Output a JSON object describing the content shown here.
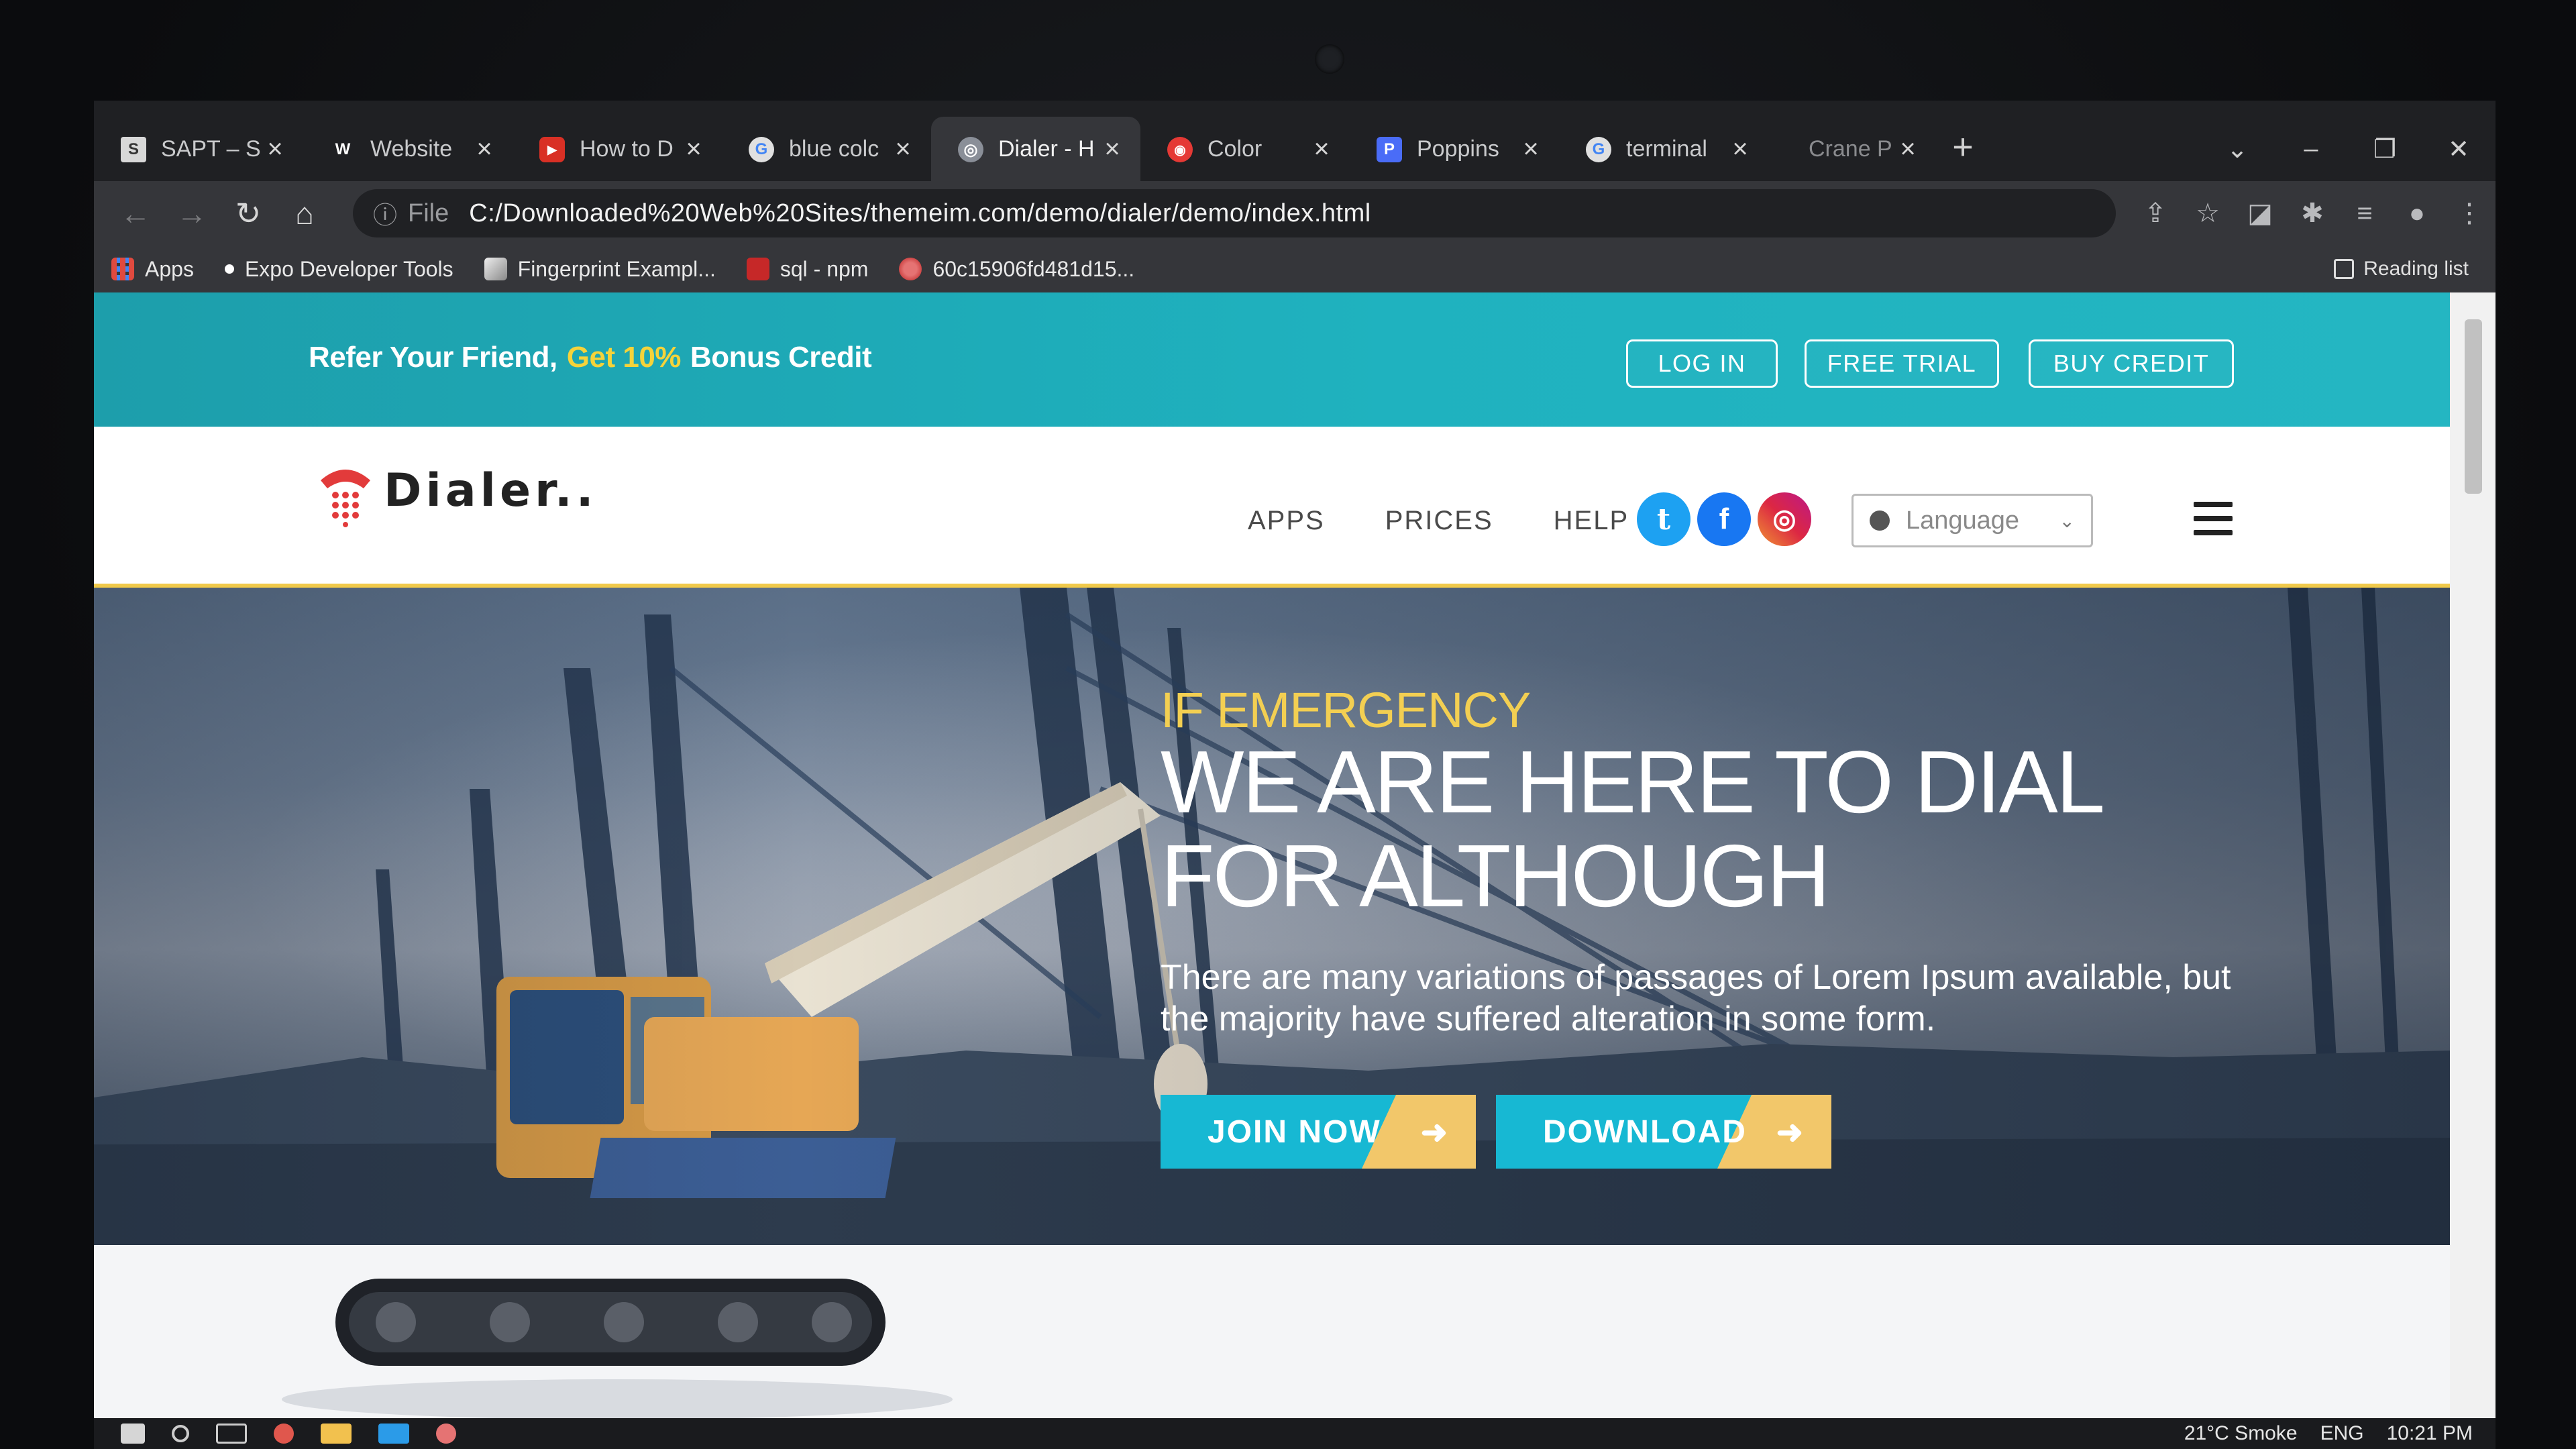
{
  "browser": {
    "tabs": [
      {
        "title": "SAPT – S",
        "favicon_color": "#d8d8d8",
        "favicon_glyph": "S",
        "active": false
      },
      {
        "title": "Website",
        "favicon_color": "#3b3b3b",
        "favicon_glyph": "W",
        "active": false
      },
      {
        "title": "How to D",
        "favicon_color": "#d93025",
        "favicon_glyph": "▶",
        "active": false
      },
      {
        "title": "blue colc",
        "favicon_color": "#e0e0e0",
        "favicon_glyph": "G",
        "active": false
      },
      {
        "title": "Dialer - H",
        "favicon_color": "#8a8f98",
        "favicon_glyph": "◎",
        "active": true
      },
      {
        "title": "Color",
        "favicon_color": "#e53935",
        "favicon_glyph": "◉",
        "active": false
      },
      {
        "title": "Poppins",
        "favicon_color": "#4a6cf7",
        "favicon_glyph": "P",
        "active": false
      },
      {
        "title": "terminal",
        "favicon_color": "#e0e0e0",
        "favicon_glyph": "G",
        "active": false
      },
      {
        "title": "Crane P",
        "favicon_color": "#1f2023",
        "favicon_glyph": "",
        "active": false
      }
    ],
    "tab_close_glyph": "×",
    "new_tab_glyph": "+",
    "window_controls": [
      "⌄",
      "–",
      "❐",
      "✕"
    ],
    "nav": {
      "back": "←",
      "forward": "→",
      "reload": "↻",
      "home": "⌂"
    },
    "address": {
      "info_icon": "ⓘ",
      "scheme": "File",
      "url": "C:/Downloaded%20Web%20Sites/themeim.com/demo/dialer/demo/index.html"
    },
    "toolbar_icons": [
      "⇪",
      "☆",
      "◪",
      "✱",
      "≡",
      "●",
      "⋮"
    ],
    "bookmarks": [
      {
        "label": "Apps",
        "color": "#e04a3f"
      },
      {
        "label": "Expo Developer Tools",
        "color": "#35363a"
      },
      {
        "label": "Fingerprint Exampl...",
        "color": "#35363a"
      },
      {
        "label": "sql - npm",
        "color": "#c62828"
      },
      {
        "label": "60c15906fd481d15...",
        "color": "#e57373"
      }
    ],
    "reading_list": "Reading list"
  },
  "promo": {
    "refer_text": "Refer Your Friend,",
    "highlight": "Get 10%",
    "bonus_text": "Bonus Credit",
    "buttons": {
      "login": "LOG IN",
      "free_trial": "FREE TRIAL",
      "buy_credit": "BUY CREDIT"
    }
  },
  "navbar": {
    "brand": "Dialer..",
    "menu": [
      "APPS",
      "PRICES",
      "HELP"
    ],
    "social": {
      "twitter": "t",
      "facebook": "f",
      "instagram": "◎"
    },
    "language_placeholder": "Language",
    "language_chevron": "⌄"
  },
  "hero": {
    "subtitle": "IF EMERGENCY",
    "title": "WE ARE HERE TO DIAL FOR ALTHOUGH",
    "text": "There are many variations of passages of Lorem Ipsum available, but the majority have suffered alteration in some form.",
    "buttons": {
      "join": "JOIN NOW",
      "download": "DOWNLOAD"
    },
    "arrow_glyph": "➜"
  },
  "taskbar": {
    "tray": {
      "weather": "21°C  Smoke",
      "lang": "ENG",
      "time": "10:21 PM"
    }
  },
  "colors": {
    "promo_teal": "#1fb2bf",
    "accent_yellow": "#f5d33a",
    "cta_blue": "#17b8d3",
    "cta_gold": "#f2c76a",
    "twitter": "#1da1f2",
    "facebook": "#1877f2",
    "instagram": "#e1306c"
  }
}
